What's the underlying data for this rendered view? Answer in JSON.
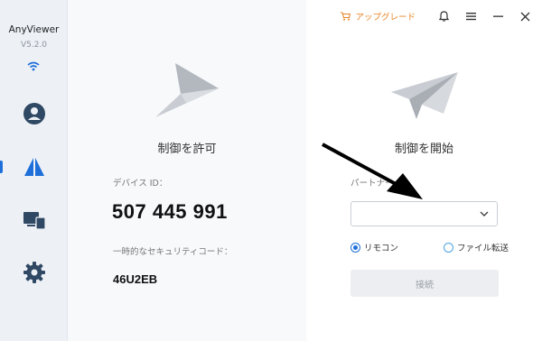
{
  "app": {
    "name": "AnyViewer",
    "version": "V5.2.0"
  },
  "sidebar": {
    "items": [
      {
        "icon": "user-icon",
        "active": false
      },
      {
        "icon": "remote-control-icon",
        "active": true
      },
      {
        "icon": "devices-icon",
        "active": false
      },
      {
        "icon": "settings-icon",
        "active": false
      }
    ]
  },
  "titlebar": {
    "upgrade_label": "アップグレード",
    "icons": [
      "cart-icon",
      "bell-icon",
      "menu-icon",
      "minimize-icon",
      "close-icon"
    ]
  },
  "allow_panel": {
    "title": "制御を許可",
    "device_id_label": "デバイス ID：",
    "device_id": "507 445 991",
    "temp_code_label": "一時的なセキュリティコード：",
    "temp_code": "46U2EB"
  },
  "control_panel": {
    "title": "制御を開始",
    "partner_label": "パートナー",
    "partner_value": "",
    "radio_remote": "リモコン",
    "radio_file": "ファイル転送",
    "connect_label": "接続"
  },
  "colors": {
    "accent": "#1e6fd9",
    "upgrade": "#e8862a",
    "sidebar_bg": "#edf1f6"
  }
}
